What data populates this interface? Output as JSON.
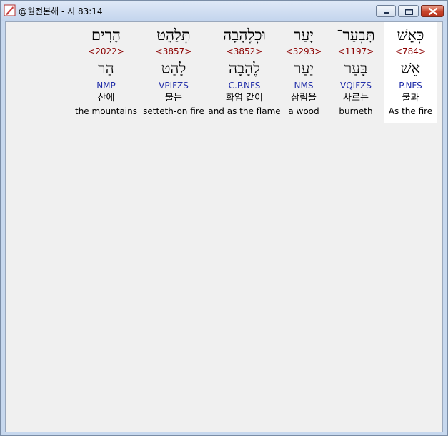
{
  "window": {
    "title": "@원전본해 - 시 83:14"
  },
  "words": [
    {
      "hebrew": "כְּאֵשׁ",
      "strong": "<784>",
      "lemma": "אֵשׁ",
      "morph": "P.NFS",
      "korean": "불과",
      "english": "As the fire",
      "selected": true
    },
    {
      "hebrew": "תִּבְעַר־",
      "strong": "<1197>",
      "lemma": "בָּעַר",
      "morph": "VQIFZS",
      "korean": "사르는",
      "english": "burneth",
      "selected": false
    },
    {
      "hebrew": "יָעַר",
      "strong": "<3293>",
      "lemma": "יַעַר",
      "morph": "NMS",
      "korean": "삼림을",
      "english": "a wood",
      "selected": false
    },
    {
      "hebrew": "וּכְלֶהָבָה",
      "strong": "<3852>",
      "lemma": "לֶהָבָה",
      "morph": "C.P.NFS",
      "korean": "화염 같이",
      "english": "and as the flame",
      "selected": false
    },
    {
      "hebrew": "תְּלַהֵט",
      "strong": "<3857>",
      "lemma": "לָהַט",
      "morph": "VPIFZS",
      "korean": "불는",
      "english": "setteth-on fire",
      "selected": false
    },
    {
      "hebrew": "הָרִים׃",
      "strong": "<2022>",
      "lemma": "הַר",
      "morph": "NMP",
      "korean": "산에",
      "english": "the mountains",
      "selected": false
    }
  ],
  "colors": {
    "strong": "#8b0000",
    "morph": "#1f2ca8",
    "selected_bg": "#ffffff",
    "client_bg": "#f0f0f0"
  },
  "icons": {
    "app": "feather-pen-icon",
    "minimize": "minimize-icon",
    "maximize": "maximize-icon",
    "close": "close-icon"
  }
}
